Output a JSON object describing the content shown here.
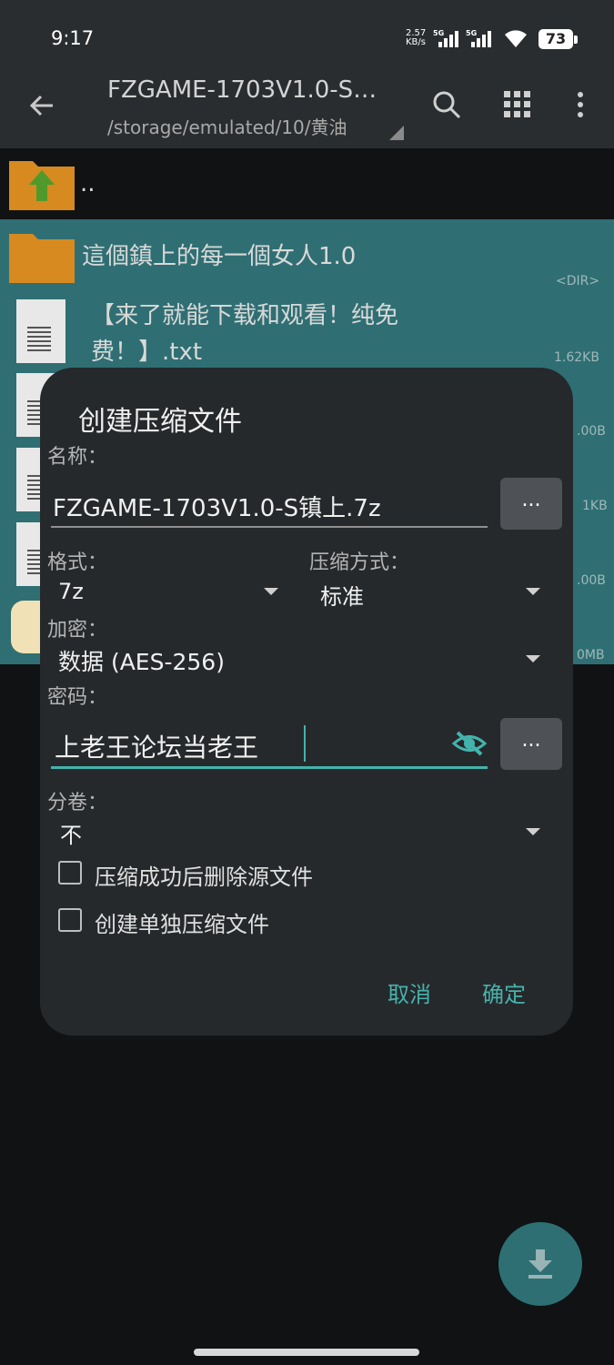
{
  "status_bar": {
    "time": "9:17",
    "net_speed_value": "2.57",
    "net_speed_unit": "KB/s",
    "signal1_label": "5G",
    "signal2_label": "5G",
    "battery": "73"
  },
  "toolbar": {
    "title": "FZGAME-1703V1.0-S…",
    "path": "/storage/emulated/10/黄油",
    "icons": [
      "back-arrow-icon",
      "search-icon",
      "grid-view-icon",
      "more-vert-icon"
    ]
  },
  "files": [
    {
      "name": "..",
      "meta": "",
      "type": "parent-folder"
    },
    {
      "name": "這個鎮上的每一個女人1.0",
      "meta": "<DIR>",
      "type": "folder",
      "selected": true
    },
    {
      "name": "【来了就能下载和观看！纯免费！】.txt",
      "meta": "1.62KB",
      "type": "text",
      "selected": true
    },
    {
      "meta": ".00B",
      "type": "file",
      "selected": true
    },
    {
      "meta": "1KB",
      "type": "file",
      "selected": true
    },
    {
      "meta": ".00B",
      "type": "file",
      "selected": true
    },
    {
      "meta": "0MB",
      "type": "app",
      "selected": true
    }
  ],
  "dialog": {
    "title": "创建压缩文件",
    "name_label": "名称：",
    "name_value": "FZGAME-1703V1.0-S镇上.7z",
    "format_label": "格式：",
    "format_value": "7z",
    "method_label": "压缩方式：",
    "method_value": "标准",
    "encryption_label": "加密：",
    "encryption_value": "数据 (AES-256)",
    "password_label": "密码：",
    "password_value": "上老王论坛当老王",
    "split_label": "分卷：",
    "split_value": "不",
    "more_label": "...",
    "delete_source_label": "压缩成功后删除源文件",
    "delete_source_checked": false,
    "separate_label": "创建单独压缩文件",
    "separate_checked": false,
    "cancel_label": "取消",
    "ok_label": "确定"
  },
  "colors": {
    "accent": "#48b2ab",
    "selected_row": "#2f6f73",
    "dialog_bg": "#26292c",
    "toolbar_bg": "#2a2d30"
  }
}
